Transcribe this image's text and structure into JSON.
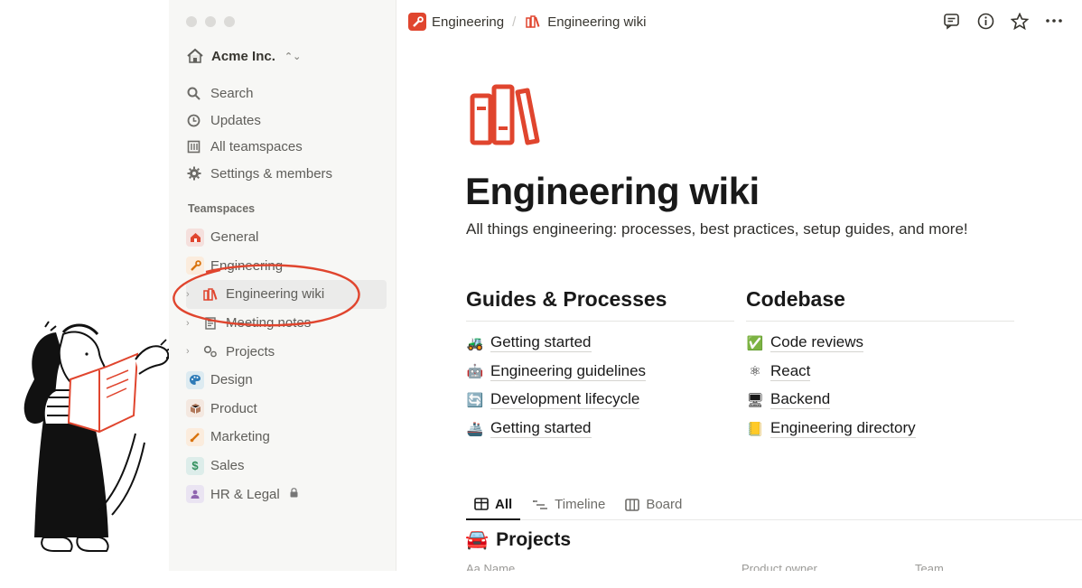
{
  "sidebar": {
    "workspace_name": "Acme Inc.",
    "nav": [
      {
        "label": "Search",
        "icon": "search-icon"
      },
      {
        "label": "Updates",
        "icon": "clock-icon"
      },
      {
        "label": "All teamspaces",
        "icon": "building-icon"
      },
      {
        "label": "Settings & members",
        "icon": "gear-icon"
      }
    ],
    "section_label": "Teamspaces",
    "teamspaces": [
      {
        "label": "General",
        "color": "#f5e0dd"
      },
      {
        "label": "Engineering",
        "color": "#fbecdd"
      },
      {
        "label": "Engineering wiki"
      },
      {
        "label": "Meeting notes"
      },
      {
        "label": "Projects"
      },
      {
        "label": "Design",
        "color": "#ddebf1"
      },
      {
        "label": "Product",
        "color": "#f4e8e0"
      },
      {
        "label": "Marketing",
        "color": "#fbecdd"
      },
      {
        "label": "Sales",
        "color": "#ddedea"
      },
      {
        "label": "HR & Legal",
        "color": "#eae4f2"
      }
    ]
  },
  "breadcrumb": {
    "parent": "Engineering",
    "separator": "/",
    "current": "Engineering wiki"
  },
  "page": {
    "title": "Engineering wiki",
    "description": "All things engineering: processes, best practices, setup guides, and more!"
  },
  "columns": {
    "left": {
      "heading": "Guides & Processes",
      "items": [
        {
          "emoji": "🚜",
          "label": "Getting started"
        },
        {
          "emoji": "🤖",
          "label": "Engineering guidelines"
        },
        {
          "emoji": "🔄",
          "label": "Development lifecycle"
        },
        {
          "emoji": "🚢",
          "label": "Getting started"
        }
      ]
    },
    "right": {
      "heading": "Codebase",
      "items": [
        {
          "emoji": "✅",
          "label": "Code reviews"
        },
        {
          "emoji": "⚛",
          "label": "React"
        },
        {
          "emoji": "🖥",
          "label": "Backend"
        },
        {
          "emoji": "📒",
          "label": "Engineering directory"
        }
      ]
    }
  },
  "tabs": [
    {
      "label": "All"
    },
    {
      "label": "Timeline"
    },
    {
      "label": "Board"
    }
  ],
  "projects": {
    "heading": "Projects",
    "emoji": "🚘",
    "properties": [
      "Aa Name",
      "Product owner",
      "Team"
    ]
  },
  "colors": {
    "accent_red": "#e0452e",
    "sidebar_bg": "#f7f7f5"
  }
}
